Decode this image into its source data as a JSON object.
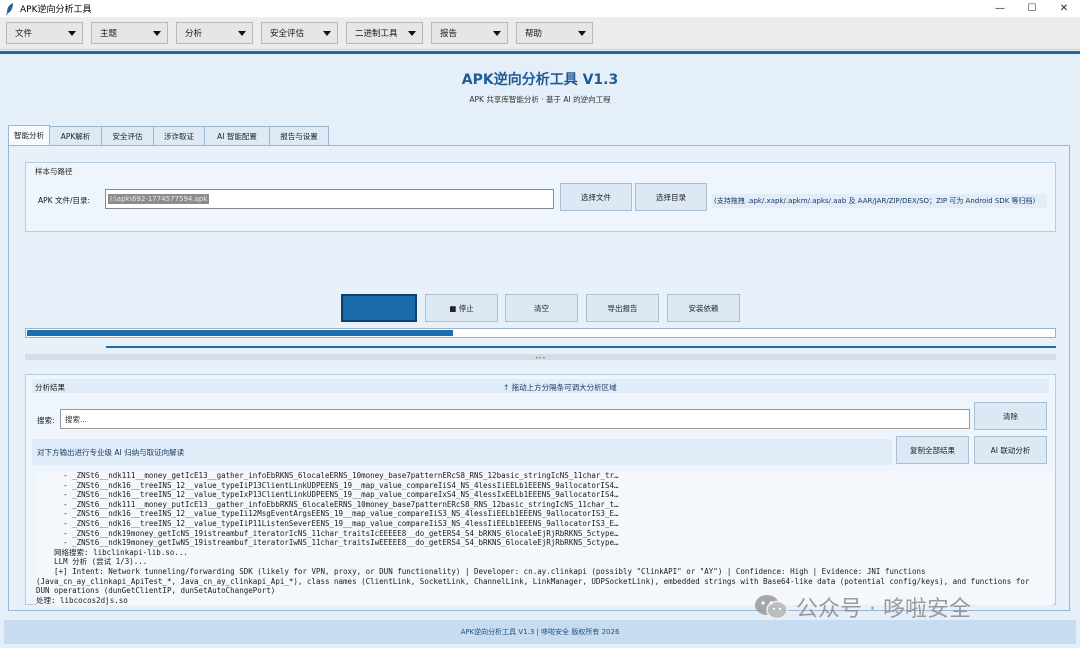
{
  "window": {
    "title": "APK逆向分析工具",
    "minimize": "—",
    "maximize": "☐",
    "close": "✕"
  },
  "menu": {
    "items": [
      "文件",
      "主题",
      "分析",
      "安全评估",
      "二进制工具",
      "报告",
      "帮助"
    ]
  },
  "header": {
    "title": "APK逆向分析工具 V1.3",
    "subtitle": "APK 共享库智能分析 · 基于 AI 的逆向工程"
  },
  "tabs": [
    "智能分析",
    "APK解析",
    "安全评估",
    "涉诈取证",
    "AI 智能配置",
    "报告与设置"
  ],
  "sample": {
    "group_label": "样本与路径",
    "apk_label": "APK 文件/目录:",
    "apk_value": "I:\\apk\\692-1774577594.apk",
    "choose_file": "选择文件",
    "choose_dir": "选择目录",
    "hint": "(支持拖拽 .apk/.xapk/.apkm/.apks/.aab 及 AAR/JAR/ZIP/DEX/SO；ZIP 可为 Android SDK 等归档)"
  },
  "actions": {
    "stop": "■ 停止",
    "clear": "清空",
    "export": "导出报告",
    "install": "安装依赖"
  },
  "progress": {
    "fraction": 0.415
  },
  "results": {
    "label": "分析结果",
    "drag_hint": "↑ 拖动上方分隔条可调大分析区域",
    "search_label": "搜索:",
    "search_placeholder": "搜索...",
    "search_clear": "清除",
    "ai_hint": "对下方输出进行专业级 AI 归纳与取证向解读",
    "copy_all": "复制全部结果",
    "ai_linked": "AI 联动分析",
    "output_lines": [
      "      - _ZNSt6__ndk111__money_getIcE13__gather_infoEbRKNS_6localeERNS_10money_base7patternERcS8_RNS_12basic_stringIcNS_11char_tr…",
      "      - _ZNSt6__ndk16__treeINS_12__value_typeIiP13ClientLinkUDPEENS_19__map_value_compareIiS4_NS_4lessIiEELb1EEENS_9allocatorIS4…",
      "      - _ZNSt6__ndk16__treeINS_12__value_typeIxP13ClientLinkUDPEENS_19__map_value_compareIxS4_NS_4lessIxEELb1EEENS_9allocatorIS4…",
      "      - _ZNSt6__ndk111__money_putIcE13__gather_infoEbbRKNS_6localeERNS_10money_base7patternERcS8_RNS_12basic_stringIcNS_11char_t…",
      "      - _ZNSt6__ndk16__treeINS_12__value_typeIi12MsgEventArgsEENS_19__map_value_compareIiS3_NS_4lessIiEELb1EEENS_9allocatorIS3_E…",
      "      - _ZNSt6__ndk16__treeINS_12__value_typeIiP11ListenSeverEENS_19__map_value_compareIiS3_NS_4lessIiEELb1EEENS_9allocatorIS3_E…",
      "      - _ZNSt6__ndk19money_getIcNS_19istreambuf_iteratorIcNS_11char_traitsIcEEEEE8__do_getERS4_S4_bRKNS_6localeEjRjRbRKNS_5ctype…",
      "      - _ZNSt6__ndk19money_getIwNS_19istreambuf_iteratorIwNS_11char_traitsIwEEEEE8__do_getERS4_S4_bRKNS_6localeEjRjRbRKNS_5ctype…",
      "    网络搜索: libclinkapi-lib.so...",
      "    LLM 分析 (尝试 1/3)...",
      "    [+] Intent: Network tunneling/forwarding SDK (likely for VPN, proxy, or DUN functionality) | Developer: cn.ay.clinkapi (possibly \"ClinkAPI\" or \"AY\") | Confidence: High | Evidence: JNI functions",
      "(Java_cn_ay_clinkapi_ApiTest_*, Java_cn_ay_clinkapi_Api_*), class names (ClientLink, SocketLink, ChannelLink, LinkManager, UDPSocketLink), embedded strings with Base64-like data (potential config/keys), and functions for",
      "DUN operations (dunGetClientIP, dunSetAutoChangePort)",
      "处理: libcocos2djs.so"
    ]
  },
  "footer": {
    "text": "APK逆向分析工具 V1.3 | 哆啦安全 版权所有 2026"
  },
  "watermark": {
    "text": "公众号 · 哆啦安全"
  }
}
